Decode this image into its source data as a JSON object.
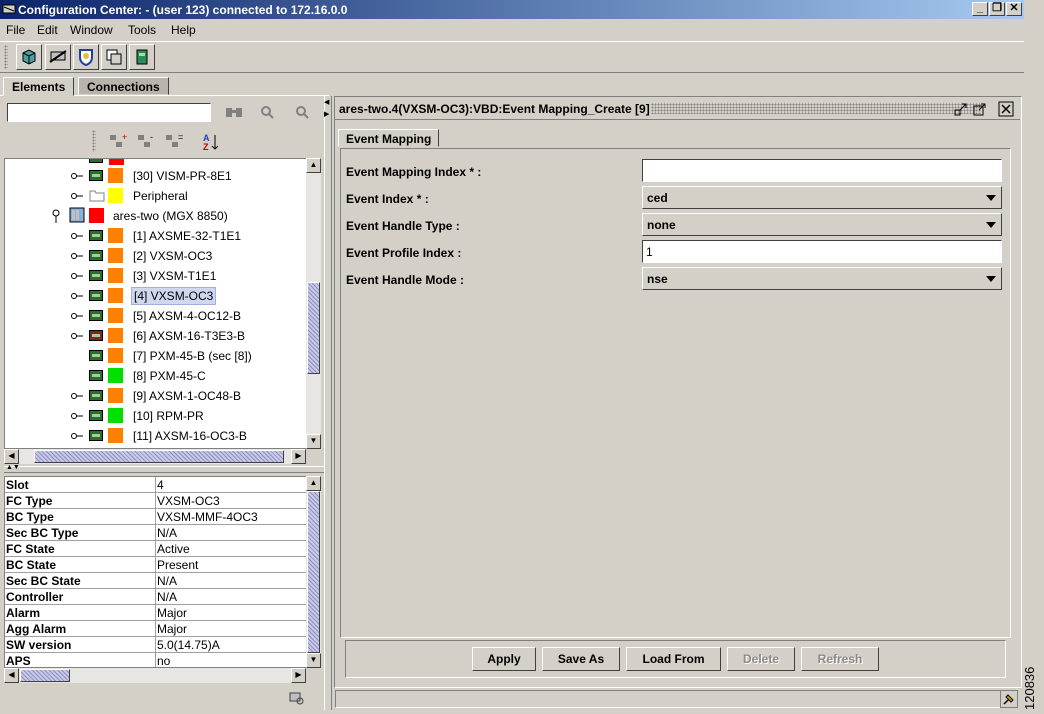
{
  "window": {
    "title": "Configuration Center: - (user 123) connected to 172.16.0.0",
    "min_icon": "minimize-icon",
    "max_icon": "restore-icon",
    "close_icon": "close-icon"
  },
  "menu": [
    {
      "label": "File"
    },
    {
      "label": "Edit"
    },
    {
      "label": "Window"
    },
    {
      "label": "Tools"
    },
    {
      "label": "Help"
    }
  ],
  "toolbar": {
    "icons": [
      "cube-icon",
      "satellite-icon",
      "shield-icon",
      "window-icon",
      "card-icon"
    ]
  },
  "tabs": {
    "elements": "Elements",
    "connections": "Connections"
  },
  "search": {
    "value": "",
    "placeholder": ""
  },
  "tree": {
    "rows": [
      {
        "label": "[30] VISM-PR-8E1",
        "status": "#ff8000",
        "icon": "card-icon"
      },
      {
        "label": "Peripheral",
        "status": "#ffff00",
        "icon": "folder-icon"
      },
      {
        "label": "ares-two (MGX 8850)",
        "status": "#ff0000",
        "icon": "node-icon"
      },
      {
        "label": "[1] AXSME-32-T1E1",
        "status": "#ff8000",
        "icon": "card-icon"
      },
      {
        "label": "[2] VXSM-OC3",
        "status": "#ff8000",
        "icon": "card-icon"
      },
      {
        "label": "[3] VXSM-T1E1",
        "status": "#ff8000",
        "icon": "card-icon"
      },
      {
        "label": "[4] VXSM-OC3",
        "status": "#ff8000",
        "icon": "card-icon"
      },
      {
        "label": "[5] AXSM-4-OC12-B",
        "status": "#ff8000",
        "icon": "card-icon"
      },
      {
        "label": "[6] AXSM-16-T3E3-B",
        "status": "#ff8000",
        "icon": "card-icon"
      },
      {
        "label": "[7] PXM-45-B (sec [8])",
        "status": "#ff8000",
        "icon": "card-icon"
      },
      {
        "label": "[8] PXM-45-C",
        "status": "#00e000",
        "icon": "card-icon"
      },
      {
        "label": "[9] AXSM-1-OC48-B",
        "status": "#ff8000",
        "icon": "card-icon"
      },
      {
        "label": "[10] RPM-PR",
        "status": "#00e000",
        "icon": "card-icon"
      },
      {
        "label": "[11] AXSM-16-OC3-B",
        "status": "#ff8000",
        "icon": "card-icon"
      }
    ]
  },
  "properties": [
    {
      "key": "Slot",
      "value": "4"
    },
    {
      "key": "FC Type",
      "value": "VXSM-OC3"
    },
    {
      "key": "BC Type",
      "value": "VXSM-MMF-4OC3"
    },
    {
      "key": "Sec BC Type",
      "value": "N/A"
    },
    {
      "key": "FC State",
      "value": "Active"
    },
    {
      "key": "BC State",
      "value": "Present"
    },
    {
      "key": "Sec BC State",
      "value": "N/A"
    },
    {
      "key": "Controller",
      "value": "N/A"
    },
    {
      "key": "Alarm",
      "value": "Major"
    },
    {
      "key": "Agg Alarm",
      "value": "Major"
    },
    {
      "key": "SW version",
      "value": "5.0(14.75)A"
    },
    {
      "key": "APS",
      "value": "no"
    }
  ],
  "frame": {
    "title": "ares-two.4(VXSM-OC3):VBD:Event Mapping_Create [9]",
    "tab": "Event Mapping"
  },
  "form": {
    "event_mapping_index": {
      "label": "Event Mapping Index * :",
      "value": ""
    },
    "event_index": {
      "label": "Event Index * :",
      "value": "ced"
    },
    "event_handle_type": {
      "label": "Event Handle Type :",
      "value": "none"
    },
    "event_profile_index": {
      "label": "Event Profile Index :",
      "value": "1"
    },
    "event_handle_mode": {
      "label": "Event Handle Mode :",
      "value": "nse"
    }
  },
  "buttons": {
    "apply": "Apply",
    "save_as": "Save As",
    "load_from": "Load From",
    "delete": "Delete",
    "refresh": "Refresh"
  },
  "figure_id": "120836"
}
